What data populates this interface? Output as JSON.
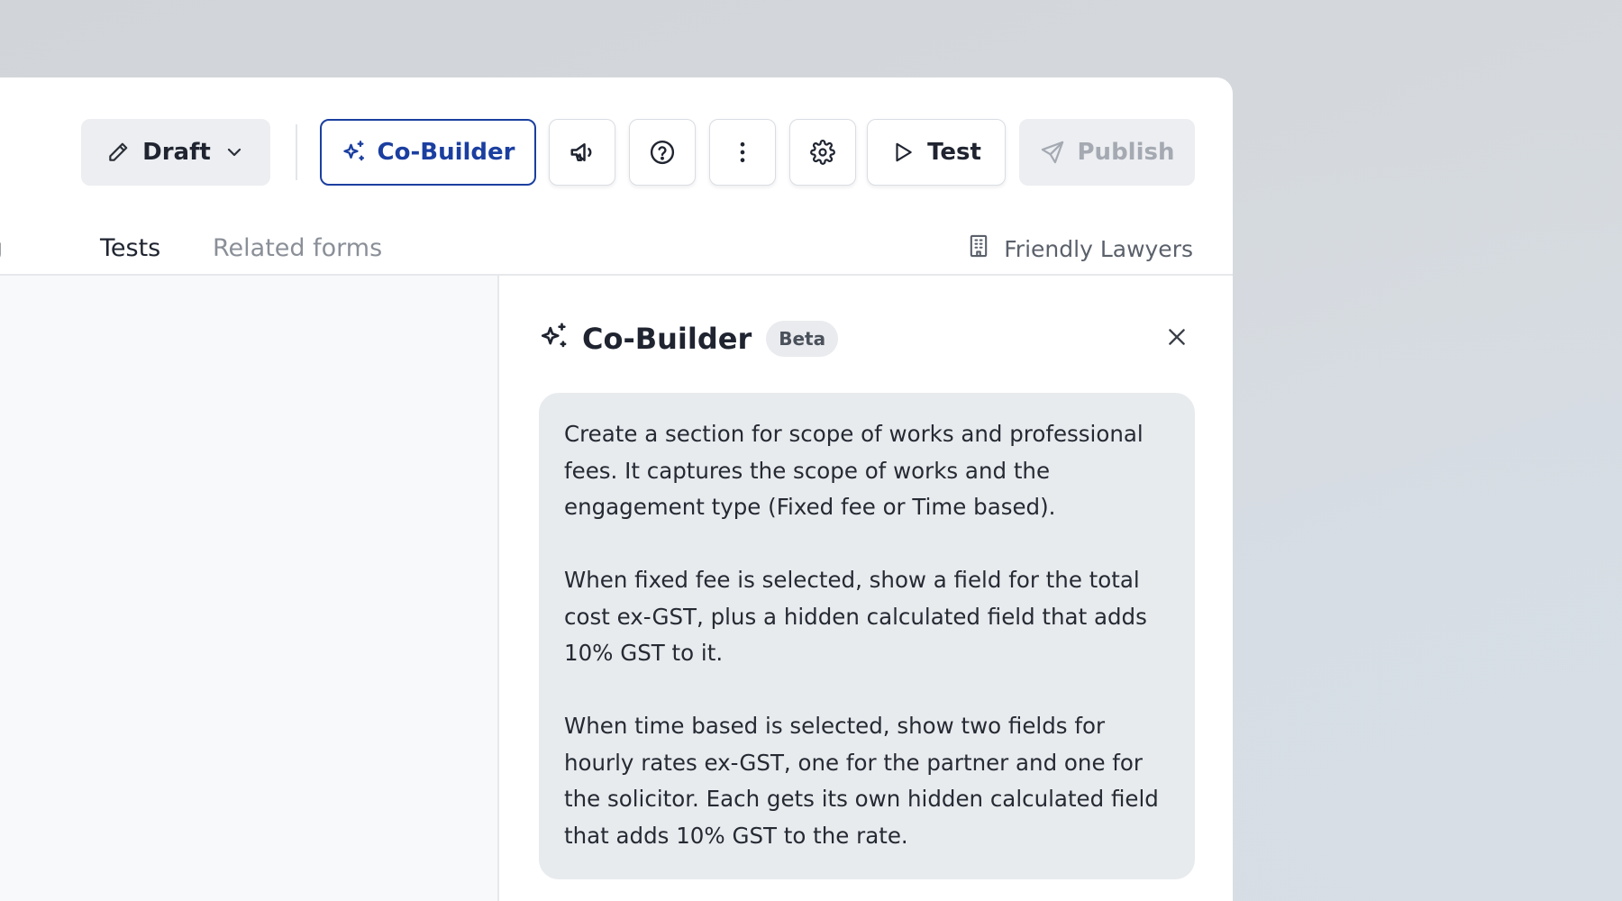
{
  "toolbar": {
    "draft_label": "Draft",
    "cobuilder_label": "Co-Builder",
    "test_label": "Test",
    "publish_label": "Publish"
  },
  "tabs": [
    {
      "label": "ping"
    },
    {
      "label": "Tests"
    },
    {
      "label": "Related forms"
    }
  ],
  "organization": "Friendly Lawyers",
  "cobuilder_panel": {
    "title": "Co-Builder",
    "badge": "Beta",
    "prompt_paragraphs": [
      "Create a section for scope of works and professional fees. It captures the scope of works and the engagement type (Fixed fee or Time based).",
      "When fixed fee is selected, show a field for the total cost ex-GST, plus a hidden calculated field that adds 10% GST to it.",
      "When time based is selected, show two fields for hourly rates ex-GST, one for the partner and one for the solicitor. Each gets its own hidden calculated field that adds 10% GST to the rate."
    ]
  },
  "icons": {
    "draft": "pencil-icon",
    "draft_menu": "chevron-down-icon",
    "cobuilder": "sparkles-icon",
    "announcements": "megaphone-icon",
    "help": "help-circle-icon",
    "more": "more-vertical-icon",
    "settings": "gear-icon",
    "test": "play-icon",
    "publish": "send-icon",
    "organization": "building-icon",
    "close": "close-icon"
  },
  "colors": {
    "accent": "#1b3fa0",
    "disabled_text": "#a4a9b2",
    "bubble_bg": "#e8ebee"
  }
}
